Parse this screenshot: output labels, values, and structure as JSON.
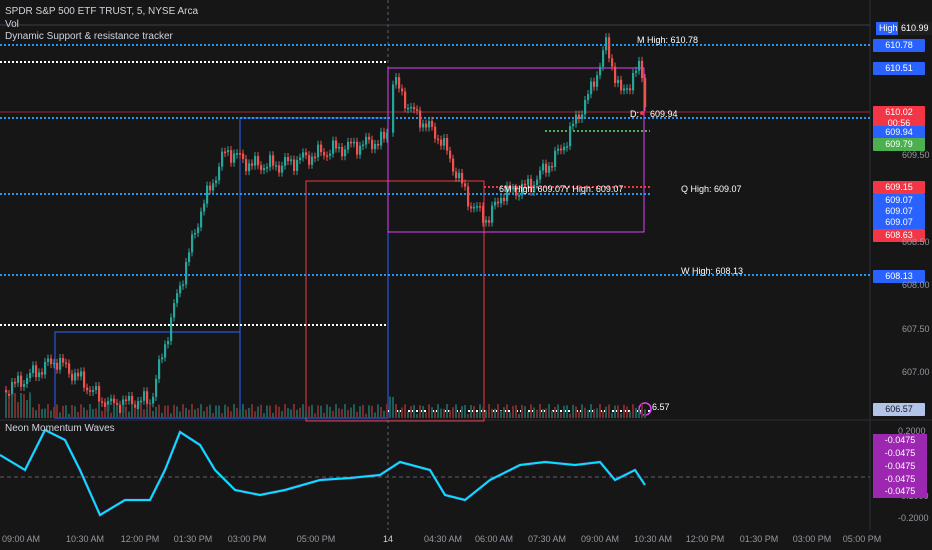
{
  "header": {
    "symbol": "SPDR S&P 500 ETF TRUST, 5, NYSE Arca",
    "vol": "Vol",
    "indicator": "Dynamic Support & resistance tracker",
    "oscillator": "Neon Momentum Waves"
  },
  "high_tag": "High",
  "high_value": "610.99",
  "price_labels": [
    {
      "text": "610.78",
      "color": "#2962ff"
    },
    {
      "text": "610.51",
      "color": "#2962ff"
    },
    {
      "text": "610.02",
      "color": "#f23645"
    },
    {
      "text": "00:56",
      "color": "#f23645"
    },
    {
      "text": "609.94",
      "color": "#2962ff"
    },
    {
      "text": "609.79",
      "color": "#4caf50"
    },
    {
      "text": "609.15",
      "color": "#f23645"
    },
    {
      "text": "609.07",
      "color": "#2962ff"
    },
    {
      "text": "609.07",
      "color": "#2962ff"
    },
    {
      "text": "609.07",
      "color": "#2962ff"
    },
    {
      "text": "608.63",
      "color": "#f23645"
    },
    {
      "text": "608.13",
      "color": "#2962ff"
    },
    {
      "text": "606.57",
      "color": "#b2c4e8"
    }
  ],
  "axis_ticks": [
    "609.50",
    "608.50",
    "608.00",
    "607.50",
    "607.00"
  ],
  "level_labels": {
    "m_high": "M High: 610.78",
    "d": "D:",
    "d_value": "609.94",
    "sixm_high": "6M High: 609.07",
    "y_high": "Y High: 609.07",
    "q_high": "Q High: 609.07",
    "w_high": "W High: 608.13",
    "e_value": "6.57"
  },
  "osc_axis": [
    "0.2000",
    "-0.1000",
    "-0.2000"
  ],
  "osc_labels": [
    "-0.0475",
    "-0.0475",
    "-0.0475",
    "-0.0475",
    "-0.0475"
  ],
  "x_ticks": [
    "09:00 AM",
    "10:30 AM",
    "12:00 PM",
    "01:30 PM",
    "03:00 PM",
    "05:00 PM",
    "14",
    "04:30 AM",
    "06:00 AM",
    "07:30 AM",
    "09:00 AM",
    "10:30 AM",
    "12:00 PM",
    "01:30 PM",
    "03:00 PM",
    "05:00 PM"
  ],
  "colors": {
    "bg": "#161616",
    "up": "#26a69a",
    "down": "#ef5350",
    "blue": "#2962ff",
    "magenta": "#e040fb",
    "red": "#f23645"
  }
}
